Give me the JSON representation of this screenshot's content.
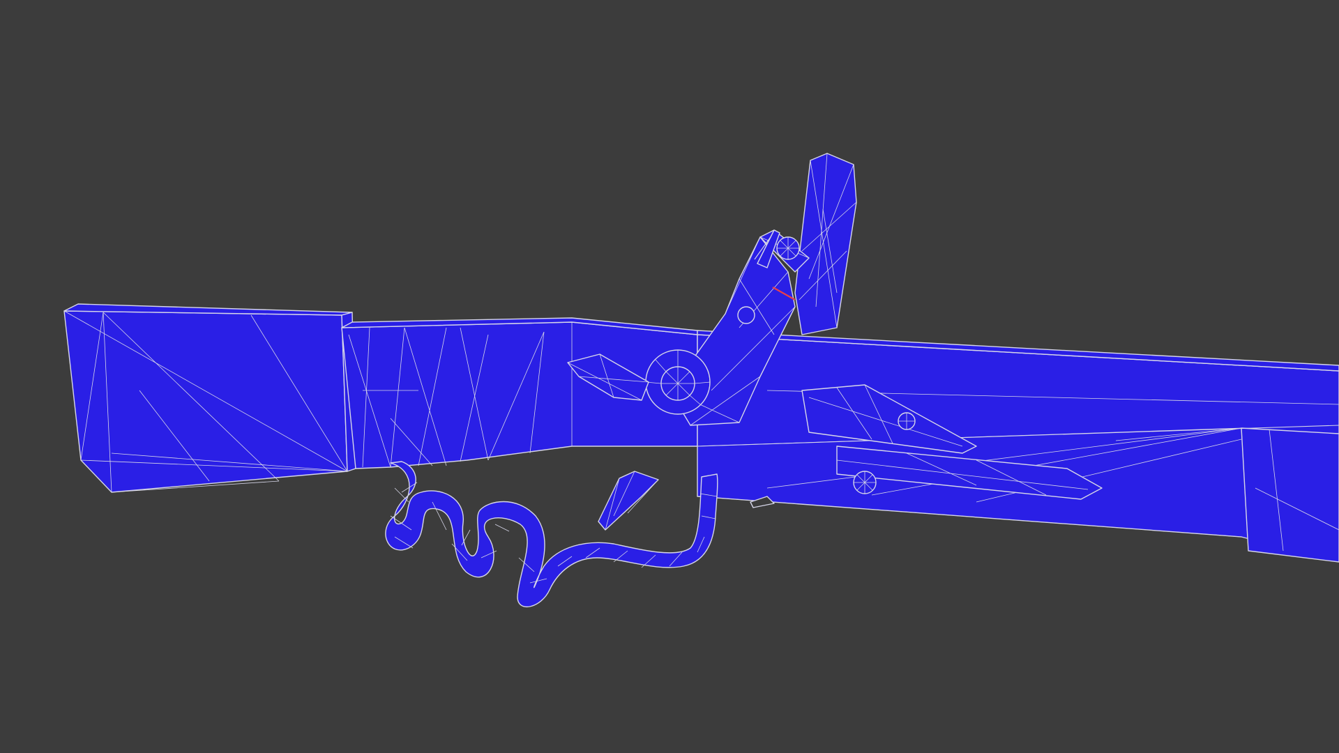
{
  "viewport": {
    "background_color": "#3c3c3c",
    "shading_mode": "wireframe-on-solid"
  },
  "model": {
    "object": "flintlock-rifle-mesh",
    "face_color": "#2a1fe6",
    "wire_color": "#d6d6e8",
    "selected_edge_color": "#e8404a"
  }
}
